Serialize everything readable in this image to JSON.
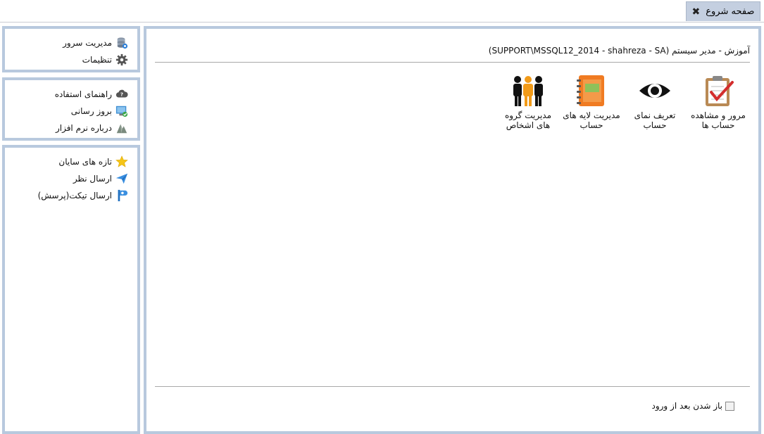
{
  "tab": {
    "title": "صفحه شروع",
    "close_icon": "close-x"
  },
  "sidebar": {
    "group1": [
      {
        "label": "مدیریت سرور",
        "icon": "server-database-icon"
      },
      {
        "label": "تنظیمات",
        "icon": "gear-icon"
      }
    ],
    "group2": [
      {
        "label": "راهنمای استفاده",
        "icon": "help-cloud-icon"
      },
      {
        "label": "بروز رسانی",
        "icon": "update-monitor-icon"
      },
      {
        "label": "درباره نرم افزار",
        "icon": "about-icon"
      }
    ],
    "group3": [
      {
        "label": "تازه های سایان",
        "icon": "star-icon"
      },
      {
        "label": "ارسال نظر",
        "icon": "send-icon"
      },
      {
        "label": "ارسال تیکت(پرسش)",
        "icon": "ticket-icon"
      }
    ]
  },
  "main": {
    "title": "آموزش - مدیر سیستم (SUPPORT\\MSSQL12_2014 - shahreza - SA)",
    "apps": [
      {
        "label": "مرور و مشاهده حساب ها",
        "icon": "clipboard-check-icon"
      },
      {
        "label": "تعریف نمای حساب",
        "icon": "eye-icon"
      },
      {
        "label": "مدیریت لایه های حساب",
        "icon": "notebook-icon"
      },
      {
        "label": "مدیریت گروه های اشخاص",
        "icon": "people-group-icon"
      }
    ],
    "startup_checkbox": {
      "label": "باز شدن بعد از ورود",
      "checked": false
    }
  },
  "colors": {
    "panel_border": "#b8c9de",
    "tab_bg": "#c4cfe0",
    "divider": "#a9a9a9"
  }
}
